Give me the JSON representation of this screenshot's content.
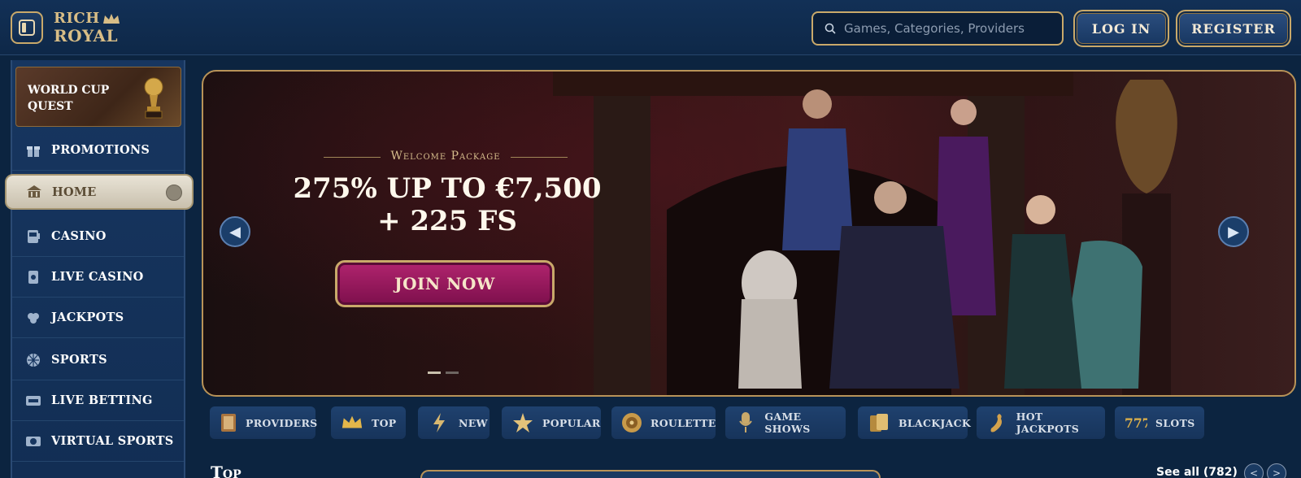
{
  "header": {
    "logo_line1": "RICH",
    "logo_line2": "ROYAL",
    "search_placeholder": "Games, Categories, Providers",
    "login_label": "LOG IN",
    "register_label": "REGISTER"
  },
  "sidebar": {
    "promo_card": {
      "title": "WORLD CUP QUEST"
    },
    "items": [
      {
        "label": "PROMOTIONS",
        "icon": "gift-icon",
        "active": false
      },
      {
        "label": "HOME",
        "icon": "home-icon",
        "active": true
      },
      {
        "label": "CASINO",
        "icon": "slot-machine-icon",
        "active": false
      },
      {
        "label": "LIVE CASINO",
        "icon": "cards-icon",
        "active": false
      },
      {
        "label": "JACKPOTS",
        "icon": "clover-icon",
        "active": false
      },
      {
        "label": "SPORTS",
        "icon": "ball-icon",
        "active": false
      },
      {
        "label": "LIVE BETTING",
        "icon": "live-icon",
        "active": false
      },
      {
        "label": "VIRTUAL SPORTS",
        "icon": "virtual-ball-icon",
        "active": false
      }
    ]
  },
  "banner": {
    "eyebrow": "Welcome Package",
    "headline_line1": "275% UP TO €7,500",
    "headline_line2": "+ 225 FS",
    "cta_label": "JOIN NOW",
    "slide_count": 2,
    "active_slide": 1
  },
  "categories": [
    {
      "label": "PROVIDERS",
      "icon": "book-icon"
    },
    {
      "label": "TOP",
      "icon": "crown-icon"
    },
    {
      "label": "NEW",
      "icon": "lightning-icon"
    },
    {
      "label": "POPULAR",
      "icon": "star-icon"
    },
    {
      "label": "ROULETTE",
      "icon": "roulette-icon"
    },
    {
      "label": "GAME SHOWS",
      "icon": "microphone-icon"
    },
    {
      "label": "BLACKJACK",
      "icon": "playing-cards-icon"
    },
    {
      "label": "HOT JACKPOTS",
      "icon": "chili-icon"
    },
    {
      "label": "SLOTS",
      "icon": "sevens-icon"
    }
  ],
  "section": {
    "title": "Top",
    "see_all": "See all (782)"
  },
  "colors": {
    "background": "#0c2440",
    "gold": "#c9a96a",
    "cta": "#b0246e"
  }
}
